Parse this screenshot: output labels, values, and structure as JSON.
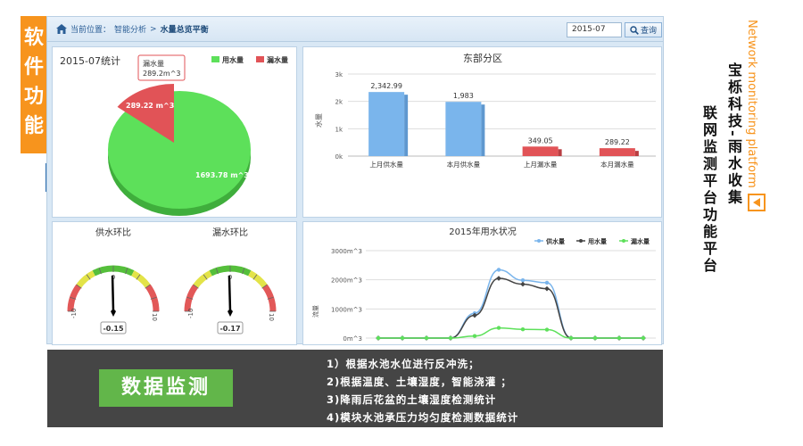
{
  "side_tag": [
    "软",
    "件",
    "功",
    "能"
  ],
  "breadcrumb": {
    "prefix": "当前位置：",
    "parent": "智能分析",
    "sep": ">",
    "current": "水量总览平衡"
  },
  "date_value": "2015-07",
  "search_label": "查询",
  "colors": {
    "green": "#5de05a",
    "red": "#e15357",
    "blue": "#7ab5ec",
    "dark": "#444444",
    "orange": "#f7941d",
    "banner_green": "#62b64a"
  },
  "pie": {
    "title": "2015-07统计",
    "legend": [
      "用水量",
      "漏水量"
    ],
    "tooltip": {
      "name": "漏水量",
      "value": "289.2m^3"
    },
    "label_small": "289.22 m^3",
    "label_large": "1693.78 m^3"
  },
  "bar": {
    "title": "东部分区",
    "ylabel": "水量",
    "ticks": [
      "0k",
      "1k",
      "2k",
      "3k"
    ],
    "labels": [
      "2,342.99",
      "1,983",
      "349.05",
      "289.22"
    ]
  },
  "gauges": {
    "title_left": "供水环比",
    "title_right": "漏水环比",
    "min_label": "-10",
    "max_label": "10",
    "zero_label": "0",
    "left_value": "-0.15",
    "right_value": "-0.17"
  },
  "line": {
    "title": "2015年用水状况",
    "legend": [
      "供水量",
      "用水量",
      "漏水量"
    ],
    "ylabel": "流量",
    "ticks": [
      "0m^3",
      "1000m^3",
      "2000m^3",
      "3000m^3"
    ]
  },
  "chart_data": [
    {
      "type": "pie",
      "title": "2015-07统计",
      "categories": [
        "用水量",
        "漏水量"
      ],
      "values": [
        1693.78,
        289.22
      ]
    },
    {
      "type": "bar",
      "title": "东部分区",
      "ylabel": "水量",
      "categories": [
        "上月供水量",
        "本月供水量",
        "上月漏水量",
        "本月漏水量"
      ],
      "values": [
        2342.99,
        1983,
        349.05,
        289.22
      ],
      "ylim": [
        0,
        3000
      ],
      "grid": true
    },
    {
      "type": "line",
      "title": "2015年用水状况",
      "ylabel": "流量",
      "ylim": [
        0,
        3000
      ],
      "x": [
        1,
        2,
        3,
        4,
        5,
        6,
        7,
        8,
        9,
        10,
        11,
        12
      ],
      "series": [
        {
          "name": "供水量",
          "values": [
            0,
            0,
            0,
            0,
            850,
            2342.99,
            1983,
            1900,
            0,
            0,
            0,
            0
          ]
        },
        {
          "name": "用水量",
          "values": [
            0,
            0,
            0,
            0,
            780,
            2050,
            1850,
            1693.78,
            0,
            0,
            0,
            0
          ]
        },
        {
          "name": "漏水量",
          "values": [
            0,
            0,
            0,
            0,
            70,
            349.05,
            300,
            289.22,
            0,
            0,
            0,
            0
          ]
        }
      ]
    }
  ],
  "banner": {
    "title": "数据监测",
    "items": [
      "1）根据水池水位进行反冲洗；",
      "2)根据温度、土壤湿度，智能浇灌 ；",
      "3)降雨后花盆的土壤湿度检测统计",
      "4)模块水池承压力均匀度检测数据统计"
    ]
  },
  "right": {
    "title1": "宝栎科技-雨水收集",
    "title2": "联网监测平台功能平台",
    "en": "Network monitoring platform"
  }
}
